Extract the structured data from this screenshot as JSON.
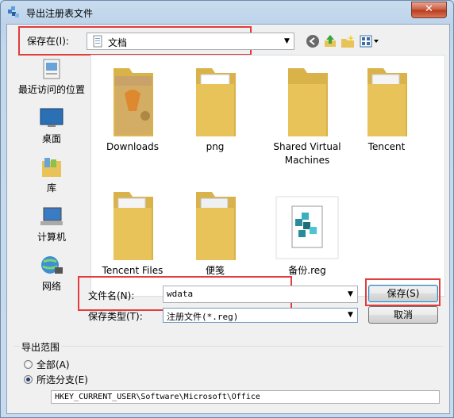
{
  "window": {
    "title": "导出注册表文件",
    "close_label": "✕"
  },
  "save_in": {
    "label": "保存在(I):",
    "value": "文档"
  },
  "places": [
    {
      "label": "最近访问的位置",
      "icon": "recent-places-icon"
    },
    {
      "label": "桌面",
      "icon": "desktop-icon"
    },
    {
      "label": "库",
      "icon": "library-icon"
    },
    {
      "label": "计算机",
      "icon": "computer-icon"
    },
    {
      "label": "网络",
      "icon": "network-icon"
    }
  ],
  "files": [
    {
      "name": "Downloads",
      "type": "folder"
    },
    {
      "name": "png",
      "type": "folder"
    },
    {
      "name": "Shared Virtual Machines",
      "type": "folder"
    },
    {
      "name": "Tencent",
      "type": "folder"
    },
    {
      "name": "Tencent Files",
      "type": "folder"
    },
    {
      "name": "便笺",
      "type": "folder"
    },
    {
      "name": "备份.reg",
      "type": "reg-file"
    }
  ],
  "filename": {
    "label": "文件名(N):",
    "value": "wdata"
  },
  "filetype": {
    "label": "保存类型(T):",
    "value": "注册文件(*.reg)"
  },
  "buttons": {
    "save": "保存(S)",
    "cancel": "取消"
  },
  "export_range": {
    "title": "导出范围",
    "all_label": "全部(A)",
    "branch_label": "所选分支(E)",
    "selected": "branch",
    "branch_path": "HKEY_CURRENT_USER\\Software\\Microsoft\\Office"
  },
  "colors": {
    "highlight_box": "#e23c3c",
    "folder": "#e8c35a"
  }
}
